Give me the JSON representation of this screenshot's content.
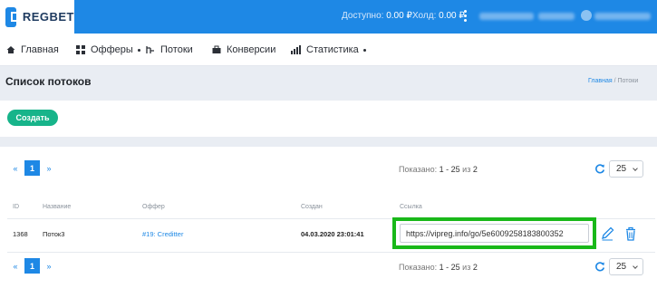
{
  "brand": {
    "name": "REGBET"
  },
  "header": {
    "available_label": "Доступно:",
    "available_value": "0.00 ₽",
    "hold_label": "Холд:",
    "hold_value": "0.00 ₽"
  },
  "nav": {
    "items": [
      {
        "label": "Главная",
        "icon": "home-icon"
      },
      {
        "label": "Офферы",
        "icon": "grid-icon"
      },
      {
        "label": "Потоки",
        "icon": "flows-icon"
      },
      {
        "label": "Конверсии",
        "icon": "briefcase-icon"
      },
      {
        "label": "Статистика",
        "icon": "chart-icon"
      }
    ]
  },
  "page": {
    "title": "Список потоков",
    "breadcrumb_home": "Главная",
    "breadcrumb_sep": "/",
    "breadcrumb_current": "Потоки"
  },
  "actions": {
    "create_label": "Создать"
  },
  "pagination": {
    "prev": "«",
    "current": "1",
    "next": "»",
    "shown_label": "Показано:",
    "range": "1 - 25",
    "of_label": "из",
    "total": "2",
    "per_page": "25"
  },
  "table": {
    "columns": [
      "ID",
      "Название",
      "Оффер",
      "Создан",
      "Ссылка"
    ],
    "rows": [
      {
        "id": "1368",
        "name": "Поток3",
        "offer": "#19: Creditter",
        "created": "04.03.2020 23:01:41",
        "link": "https://vipreg.info/go/5e6009258183800352"
      }
    ]
  },
  "colors": {
    "primary": "#1e88e5",
    "create_button": "#17b48a",
    "highlight": "#19b819"
  }
}
